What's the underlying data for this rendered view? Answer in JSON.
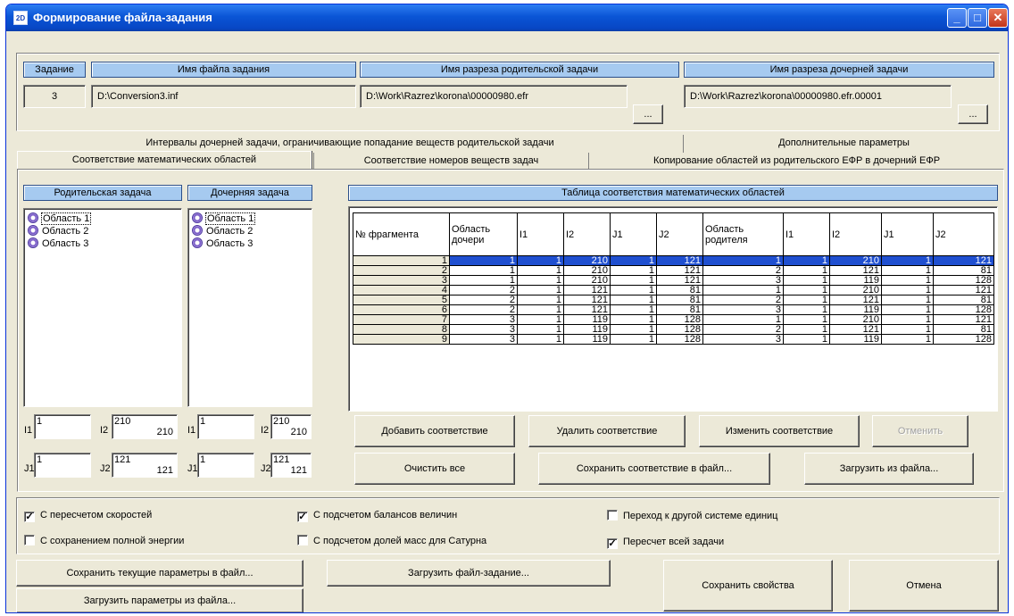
{
  "window": {
    "title": "Формирование файла-задания",
    "icon": "2D"
  },
  "top": {
    "task_header": "Задание",
    "task_value": "3",
    "file_header": "Имя файла задания",
    "file_value": "D:\\Conversion3.inf",
    "parent_header": "Имя разреза родительской задачи",
    "parent_value": "D:\\Work\\Razrez\\korona\\00000980.efr",
    "child_header": "Имя разреза дочерней задачи",
    "child_value": "D:\\Work\\Razrez\\korona\\00000980.efr.00001",
    "browse_label": "..."
  },
  "tabs": {
    "row1": [
      "Интервалы дочерней задачи, ограничивающие попадание веществ родительской задачи",
      "Дополнительные параметры"
    ],
    "row2": [
      "Соответствие математических областей",
      "Соответствие номеров веществ задач",
      "Копирование областей из родительского ЕФР в дочерний ЕФР"
    ]
  },
  "parent_panel": {
    "header": "Родительская задача",
    "items": [
      "Область 1",
      "Область 2",
      "Область 3"
    ],
    "i1_label": "I1",
    "i1_value": "1",
    "i2_label": "I2",
    "i2_value": "210",
    "i2_sub": "210",
    "j1_label": "J1",
    "j1_value": "1",
    "j2_label": "J2",
    "j2_value": "121",
    "j2_sub": "121"
  },
  "child_panel": {
    "header": "Дочерняя задача",
    "items": [
      "Область 1",
      "Область 2",
      "Область 3"
    ],
    "i1_label": "I1",
    "i1_value": "1",
    "i2_label": "I2",
    "i2_value": "210",
    "i2_sub": "210",
    "j1_label": "J1",
    "j1_value": "1",
    "j2_label": "J2",
    "j2_value": "121",
    "j2_sub": "121"
  },
  "table": {
    "header": "Таблица соответствия математических областей",
    "columns": [
      "№ фрагмента",
      "Область дочери",
      "I1",
      "I2",
      "J1",
      "J2",
      "Область родителя",
      "I1",
      "I2",
      "J1",
      "J2"
    ],
    "rows": [
      [
        "1",
        "1",
        "1",
        "210",
        "1",
        "121",
        "1",
        "1",
        "210",
        "1",
        "121"
      ],
      [
        "2",
        "1",
        "1",
        "210",
        "1",
        "121",
        "2",
        "1",
        "121",
        "1",
        "81"
      ],
      [
        "3",
        "1",
        "1",
        "210",
        "1",
        "121",
        "3",
        "1",
        "119",
        "1",
        "128"
      ],
      [
        "4",
        "2",
        "1",
        "121",
        "1",
        "81",
        "1",
        "1",
        "210",
        "1",
        "121"
      ],
      [
        "5",
        "2",
        "1",
        "121",
        "1",
        "81",
        "2",
        "1",
        "121",
        "1",
        "81"
      ],
      [
        "6",
        "2",
        "1",
        "121",
        "1",
        "81",
        "3",
        "1",
        "119",
        "1",
        "128"
      ],
      [
        "7",
        "3",
        "1",
        "119",
        "1",
        "128",
        "1",
        "1",
        "210",
        "1",
        "121"
      ],
      [
        "8",
        "3",
        "1",
        "119",
        "1",
        "128",
        "2",
        "1",
        "121",
        "1",
        "81"
      ],
      [
        "9",
        "3",
        "1",
        "119",
        "1",
        "128",
        "3",
        "1",
        "119",
        "1",
        "128"
      ]
    ],
    "selected_row": 0
  },
  "table_buttons": {
    "add": "Добавить соответствие",
    "delete": "Удалить соответствие",
    "edit": "Изменить соответствие",
    "cancel": "Отменить",
    "clear": "Очистить все",
    "save": "Сохранить соответствие в файл...",
    "load": "Загрузить из файла..."
  },
  "options": {
    "opt1": "С пересчетом скоростей",
    "opt2": "С подсчетом балансов величин",
    "opt3": "Переход к другой системе единиц",
    "opt4": "С сохранением полной энергии",
    "opt5": "С подсчетом долей масс для Сатурна",
    "opt6": "Пересчет всей задачи",
    "check_mark": "✓"
  },
  "bottom": {
    "save_params": "Сохранить текущие параметры в файл...",
    "load_task": "Загрузить файл-задание...",
    "load_params": "Загрузить параметры из файла...",
    "save_props": "Сохранить свойства",
    "cancel": "Отмена"
  },
  "colors": {
    "titlebar": "#0a55d6",
    "header_fill": "#a6caf0",
    "selection": "#1f4fd0",
    "window_bg": "#ece9d8"
  }
}
